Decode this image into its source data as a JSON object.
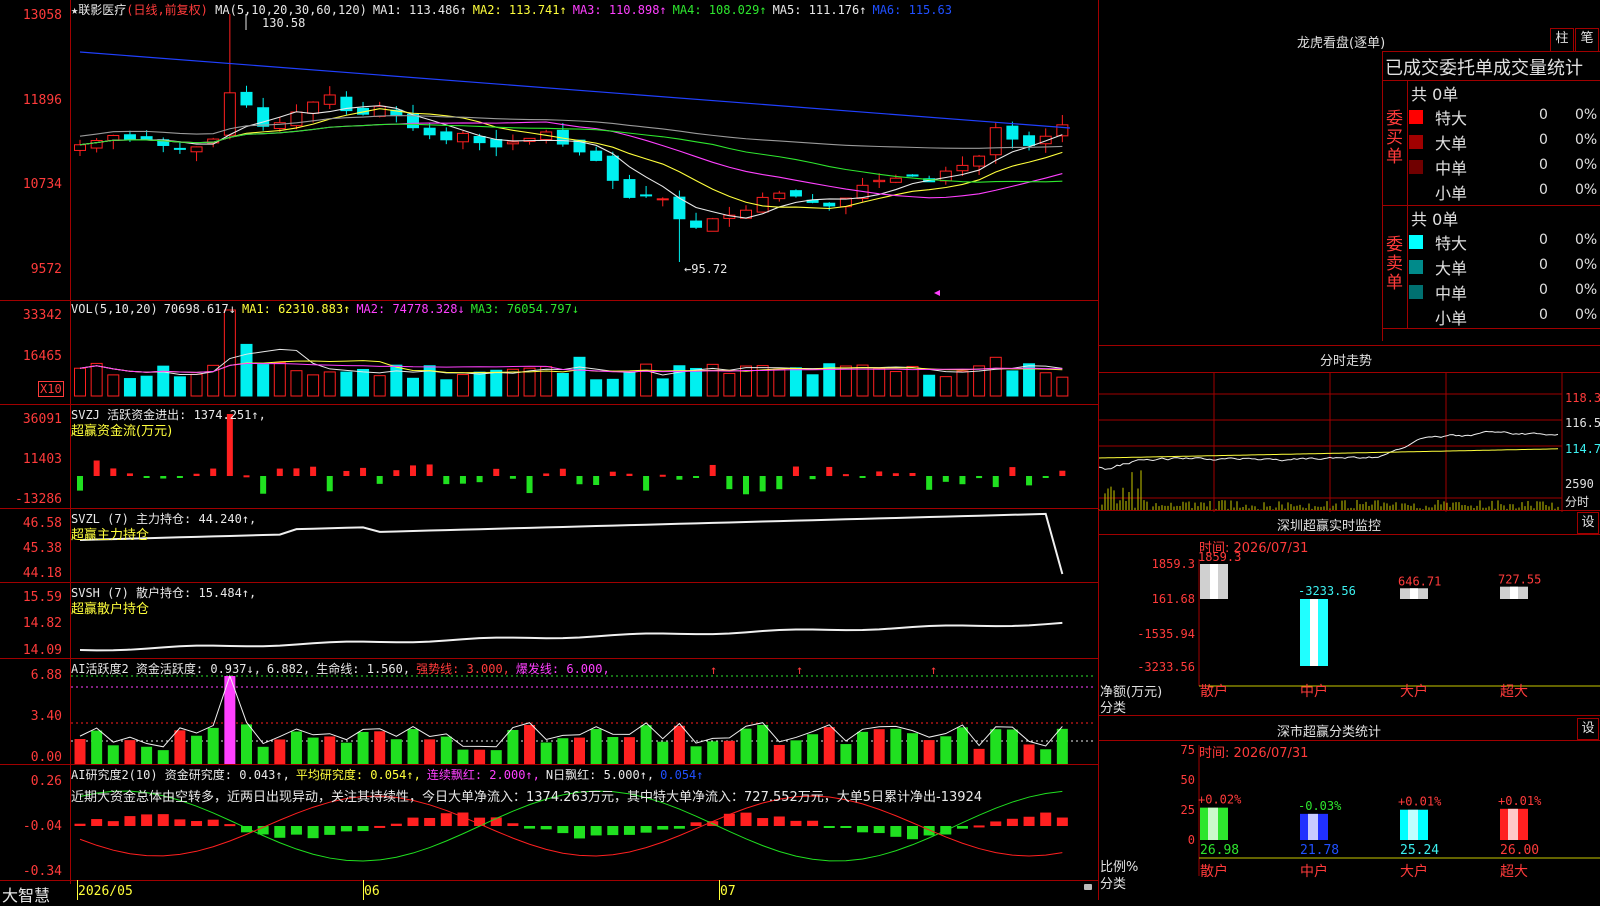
{
  "stock": {
    "name": "★联影医疗",
    "mode": "(日线,前复权)"
  },
  "main": {
    "ma_header": [
      {
        "t": "MA(5,10,20,30,60,120)",
        "c": "wht"
      },
      {
        "t": "MA1: 113.486↑",
        "c": "wht"
      },
      {
        "t": "MA2: 113.741↑",
        "c": "yel"
      },
      {
        "t": "MA3: 110.898↑",
        "c": "mag"
      },
      {
        "t": "MA4: 108.029↑",
        "c": "grn"
      },
      {
        "t": "MA5: 111.176↑",
        "c": "wht"
      },
      {
        "t": "MA6: 115.63",
        "c": "blu"
      }
    ],
    "y_ticks": [
      "13058",
      "11896",
      "10734",
      "9572"
    ],
    "high_note": "130.58",
    "low_note": "←95.72"
  },
  "vol": {
    "header": [
      {
        "t": "VOL(5,10,20)",
        "c": "wht"
      },
      {
        "t": "70698.617↓",
        "c": "wht"
      },
      {
        "t": "MA1: 62310.883↑",
        "c": "yel"
      },
      {
        "t": "MA2: 74778.328↓",
        "c": "mag"
      },
      {
        "t": "MA3: 76054.797↓",
        "c": "grn"
      }
    ],
    "y_ticks": [
      "33342",
      "16465"
    ],
    "unit": "X10"
  },
  "svzj": {
    "header": [
      {
        "t": "SVZJ  活跃资金进出: 1374.251↑,",
        "c": "wht"
      }
    ],
    "sub": "超赢资金流(万元)",
    "y_ticks": [
      "36091",
      "11403",
      "-13286"
    ]
  },
  "svzl": {
    "header": [
      {
        "t": "SVZL (7) 主力持仓: 44.240↑,",
        "c": "wht"
      }
    ],
    "sub": "超赢主力持仓",
    "y_ticks": [
      "46.58",
      "45.38",
      "44.18"
    ]
  },
  "svsh": {
    "header": [
      {
        "t": "SVSH (7) 散户持仓: 15.484↑,",
        "c": "wht"
      }
    ],
    "sub": "超赢散户持仓",
    "y_ticks": [
      "15.59",
      "14.82",
      "14.09"
    ]
  },
  "ai1": {
    "header": [
      {
        "t": "AI活跃度2 资金活跃度: 0.937↓,",
        "c": "wht"
      },
      {
        "t": "6.882,",
        "c": "wht"
      },
      {
        "t": "生命线: 1.560,",
        "c": "wht"
      },
      {
        "t": "强势线: 3.000,",
        "c": "red"
      },
      {
        "t": "爆发线: 6.000,",
        "c": "mag"
      }
    ],
    "y_ticks": [
      "6.88",
      "3.40",
      "0.00"
    ]
  },
  "ai2": {
    "header": [
      {
        "t": "AI研究度2(10) 资金研究度: 0.043↑,",
        "c": "wht"
      },
      {
        "t": "平均研究度: 0.054↑,",
        "c": "yel"
      },
      {
        "t": "连续飘红: 2.000↑,",
        "c": "mag"
      },
      {
        "t": "N日飘红: 5.000↑,",
        "c": "wht"
      },
      {
        "t": "0.054↑",
        "c": "blu"
      }
    ],
    "note": "近期大资金总体由空转多，近两日出现异动，关注其持续性，今日大单净流入：1374.263万元，其中特大单净流入：727.552万元，大单5日累计净出-13924",
    "y_ticks": [
      "0.26",
      "-0.04",
      "-0.34"
    ]
  },
  "xaxis": {
    "brand": "大智慧",
    "labels": [
      "2026/05",
      "06",
      "07"
    ]
  },
  "dragon": {
    "title": "龙虎看盘(逐单)",
    "btn_zhu": "柱",
    "btn_bi": "笔",
    "subtitle": "已成交委托单成交量统计",
    "buy_label": "委买单",
    "sell_label": "委卖单",
    "buy_total": "共 0单",
    "sell_total": "共 0单",
    "buy_rows": [
      {
        "label": "特大",
        "count": "0",
        "pct": "0%",
        "color": "#ff0000"
      },
      {
        "label": "大单",
        "count": "0",
        "pct": "0%",
        "color": "#a00000"
      },
      {
        "label": "中单",
        "count": "0",
        "pct": "0%",
        "color": "#700000"
      },
      {
        "label": "小单",
        "count": "0",
        "pct": "0%",
        "color": ""
      }
    ],
    "sell_rows": [
      {
        "label": "特大",
        "count": "0",
        "pct": "0%",
        "color": "#00ffff"
      },
      {
        "label": "大单",
        "count": "0",
        "pct": "0%",
        "color": "#008a8a"
      },
      {
        "label": "中单",
        "count": "0",
        "pct": "0%",
        "color": "#007070"
      },
      {
        "label": "小单",
        "count": "0",
        "pct": "0%",
        "color": ""
      }
    ]
  },
  "intraday": {
    "title": "分时走势",
    "y_ticks": [
      "118.3",
      "116.5",
      "114.7"
    ],
    "vol_tick": "2590",
    "tab": "分时"
  },
  "monitor": {
    "title": "深圳超赢实时监控",
    "btn": "设",
    "time": "时间: 2026/07/31",
    "y_ticks": [
      "1859.3",
      "161.68",
      "-1535.94",
      "-3233.56"
    ],
    "row_label": "净额(万元)",
    "row_label2": "分类",
    "bars": [
      {
        "cat": "散户",
        "value": 1859.3,
        "label": "1859.3",
        "label_color": "#ff3b3b"
      },
      {
        "cat": "中户",
        "value": -3233.56,
        "label": "-3233.56",
        "label_color": "#3cf0f0"
      },
      {
        "cat": "大户",
        "value": 646.71,
        "label": "646.71",
        "label_color": "#ff3b3b"
      },
      {
        "cat": "超大",
        "value": 727.55,
        "label": "727.55",
        "label_color": "#ff3b3b"
      }
    ]
  },
  "classify": {
    "title": "深市超赢分类统计",
    "btn": "设",
    "time": "时间: 2026/07/31",
    "y_ticks": [
      "75",
      "50",
      "25",
      "0"
    ],
    "row_label": "比例%",
    "row_label2": "分类",
    "bars": [
      {
        "cat": "散户",
        "value": 26.98,
        "label": "26.98",
        "chg": "+0.02%",
        "chg_color": "#ff3b3b",
        "bar_color": "#2ee62e",
        "label_color": "#2ee62e"
      },
      {
        "cat": "中户",
        "value": 21.78,
        "label": "21.78",
        "chg": "-0.03%",
        "chg_color": "#2ee62e",
        "bar_color": "#2030ff",
        "label_color": "#2050ff"
      },
      {
        "cat": "大户",
        "value": 25.24,
        "label": "25.24",
        "chg": "+0.01%",
        "chg_color": "#ff3b3b",
        "bar_color": "#00ffff",
        "label_color": "#3cf0f0"
      },
      {
        "cat": "超大",
        "value": 26.0,
        "label": "26.00",
        "chg": "+0.01%",
        "chg_color": "#ff3b3b",
        "bar_color": "#ff2020",
        "label_color": "#ff3b3b"
      }
    ]
  },
  "colors": {
    "up": "#ff2020",
    "down": "#00f0f0",
    "grid": "#a00000"
  }
}
